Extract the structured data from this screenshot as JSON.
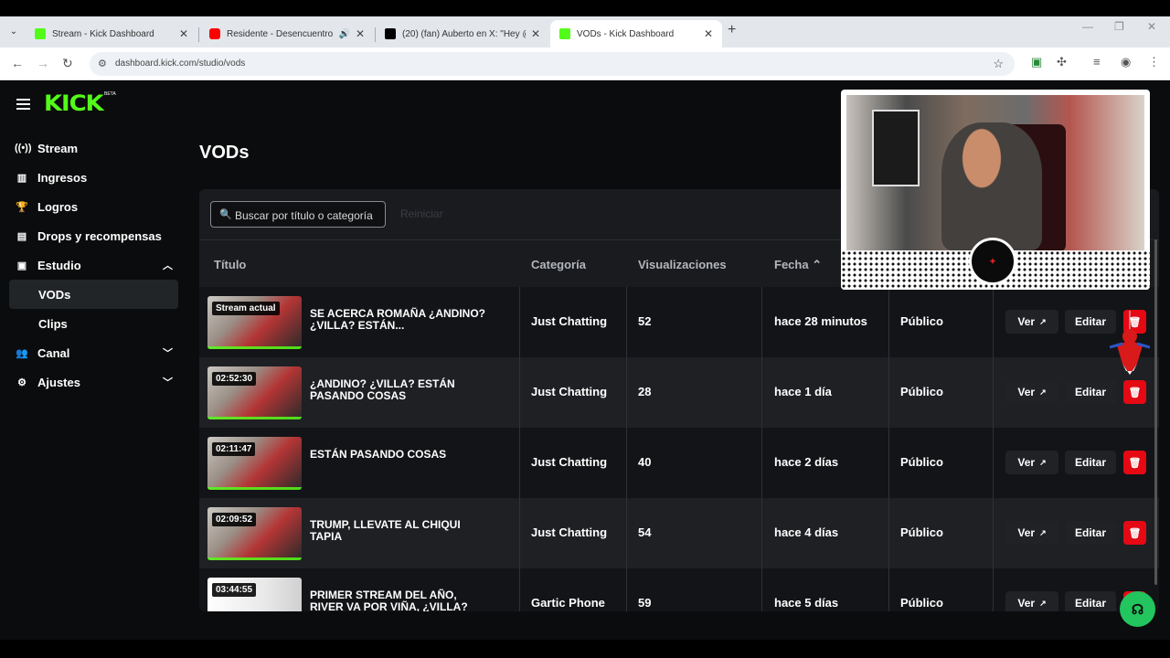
{
  "browser": {
    "tabs": [
      {
        "title": "Stream - Kick Dashboard",
        "favicon_color": "#53fc18",
        "active": false
      },
      {
        "title": "Residente - Desencuentro (",
        "favicon_color": "#ff0000",
        "active": false
      },
      {
        "title": "(20) (fan) Auberto en X: \"Hey @",
        "favicon_color": "#000000",
        "active": false
      },
      {
        "title": "VODs - Kick Dashboard",
        "favicon_color": "#53fc18",
        "active": true
      }
    ],
    "url": "dashboard.kick.com/studio/vods",
    "icons": {
      "back": "arrow-left-icon",
      "forward": "arrow-right-icon",
      "reload": "reload-icon",
      "bookmark": "star-icon"
    }
  },
  "app": {
    "logo": "KICK",
    "logo_badge": "BETA",
    "brand_color": "#53fc18",
    "sidebar": {
      "items": [
        {
          "label": "Stream",
          "icon": "live-icon"
        },
        {
          "label": "Ingresos",
          "icon": "chart-icon"
        },
        {
          "label": "Logros",
          "icon": "trophy-icon"
        },
        {
          "label": "Drops y recompensas",
          "icon": "gift-icon"
        },
        {
          "label": "Estudio",
          "icon": "video-icon",
          "expanded": true
        },
        {
          "label": "VODs",
          "active": true
        },
        {
          "label": "Clips"
        },
        {
          "label": "Canal",
          "icon": "people-icon",
          "expandable": true
        },
        {
          "label": "Ajustes",
          "icon": "gear-icon",
          "expandable": true
        }
      ]
    },
    "page_title": "VODs",
    "search": {
      "placeholder": "Buscar por título o categoría"
    },
    "reset_label": "Reiniciar",
    "columns": {
      "title": "Título",
      "category": "Categoría",
      "views": "Visualizaciones",
      "date": "Fecha"
    },
    "actions": {
      "view": "Ver",
      "edit": "Editar"
    },
    "vods": [
      {
        "badge": "Stream actual",
        "title": "SE ACERCA ROMAÑA ¿ANDINO? ¿VILLA? ESTÁN...",
        "category": "Just Chatting",
        "views": "52",
        "date": "hace 28 minutos",
        "visibility": "Público",
        "thumb": "cam"
      },
      {
        "badge": "02:52:30",
        "title": "¿ANDINO? ¿VILLA? ESTÁN PASANDO COSAS",
        "category": "Just Chatting",
        "views": "28",
        "date": "hace 1 día",
        "visibility": "Público",
        "thumb": "cam"
      },
      {
        "badge": "02:11:47",
        "title": "ESTÁN PASANDO COSAS",
        "category": "Just Chatting",
        "views": "40",
        "date": "hace 2 días",
        "visibility": "Público",
        "thumb": "cam"
      },
      {
        "badge": "02:09:52",
        "title": "TRUMP, LLEVATE AL CHIQUI TAPIA",
        "category": "Just Chatting",
        "views": "54",
        "date": "hace 4 días",
        "visibility": "Público",
        "thumb": "cam"
      },
      {
        "badge": "03:44:55",
        "title": "PRIMER STREAM DEL AÑO, RIVER VA POR VIÑA, ¿VILLA?",
        "category": "Gartic Phone",
        "views": "59",
        "date": "hace 5 días",
        "visibility": "Público",
        "thumb": "light"
      }
    ]
  }
}
